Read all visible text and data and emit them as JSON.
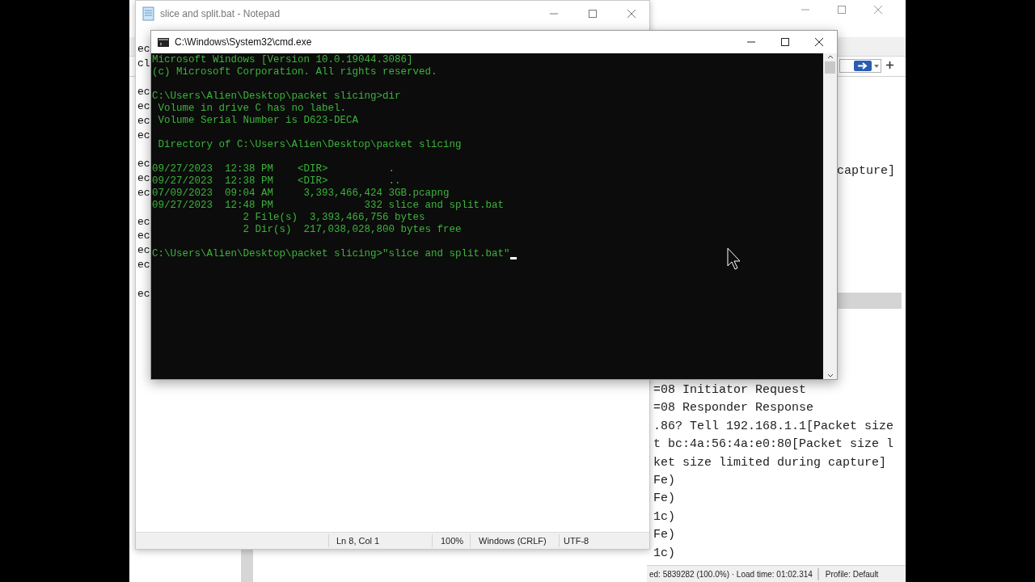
{
  "wireshark": {
    "visible_text": "capture]",
    "packet_lines": [
      "=08 Initiator Request",
      "=08 Responder Response",
      ".86? Tell 192.168.1.1[Packet size",
      "t bc:4a:56:4a:e0:80[Packet size l",
      "ket size limited during capture]",
      "Fe)",
      "Fe)",
      "1c)",
      "Fe)",
      "1c)"
    ],
    "status": {
      "packets": "ed: 5839282 (100.0%) · Load time: 01:02.314",
      "profile": "Profile: Default"
    }
  },
  "notepad": {
    "title": "slice and split.bat - Notepad",
    "blocks": [
      [
        "ec",
        "cl"
      ],
      [
        "ec",
        "ec",
        "ec",
        "ec"
      ],
      [
        "ec",
        "ec",
        "ec"
      ],
      [
        "ec",
        "ec",
        "ec",
        "ec"
      ],
      [
        "ec"
      ]
    ],
    "status": [
      "Ln 8, Col 1",
      "100%",
      "Windows (CRLF)",
      "UTF-8"
    ]
  },
  "cmd": {
    "title": "C:\\Windows\\System32\\cmd.exe",
    "blocks": [
      [
        "Microsoft Windows [Version 10.0.19044.3086]",
        "(c) Microsoft Corporation. All rights reserved."
      ],
      [
        "C:\\Users\\Alien\\Desktop\\packet slicing>dir",
        " Volume in drive C has no label.",
        " Volume Serial Number is D623-DECA"
      ],
      [
        " Directory of C:\\Users\\Alien\\Desktop\\packet slicing"
      ],
      [
        "09/27/2023  12:38 PM    <DIR>          .",
        "09/27/2023  12:38 PM    <DIR>          ..",
        "07/09/2023  09:04 AM     3,393,466,424 3GB.pcapng",
        "09/27/2023  12:48 PM               332 slice and split.bat",
        "               2 File(s)  3,393,466,756 bytes",
        "               2 Dir(s)  217,038,028,800 bytes free"
      ],
      [
        "C:\\Users\\Alien\\Desktop\\packet slicing>\"slice and split.bat\""
      ]
    ]
  }
}
